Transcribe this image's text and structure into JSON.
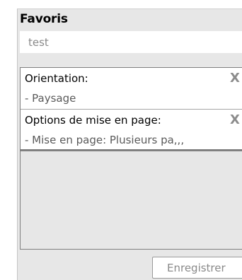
{
  "favorites": {
    "title": "Favoris",
    "name_value": "test",
    "items": [
      {
        "label": "Orientation:",
        "value": "- Paysage",
        "remove_label": "X"
      },
      {
        "label": "Options de mise en page:",
        "value": "- Mise en page: Plusieurs pa,,,",
        "remove_label": "X"
      }
    ],
    "save_label": "Enregistrer"
  }
}
